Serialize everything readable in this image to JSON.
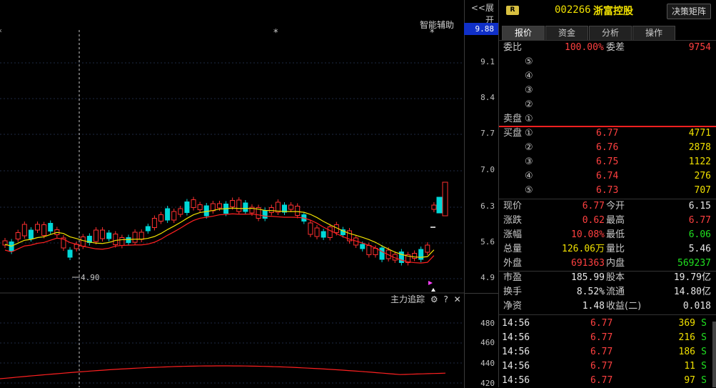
{
  "chart": {
    "expand_label": "<<展开",
    "smart_assist_label": "智能辅助",
    "current_price_tag": "9.88",
    "price_ticks": [
      "9.1",
      "8.4",
      "7.7",
      "7.0",
      "6.3",
      "5.6",
      "4.9"
    ],
    "low_annotation": "4.90",
    "main_track_label": "主力追踪",
    "vol_ticks": [
      "480",
      "460",
      "440",
      "420"
    ],
    "colors": {
      "up": "#ff3030",
      "down": "#00d8d8",
      "ma_yellow": "#f0e000",
      "ma_red": "#ff2020",
      "grid": "#2a2a3a"
    }
  },
  "header": {
    "badge": "R",
    "code": "002266",
    "name": "浙富控股",
    "decision_button": "决策矩阵"
  },
  "tabs": [
    "报价",
    "资金",
    "分析",
    "操作"
  ],
  "commission": {
    "ratio_label": "委比",
    "ratio_value": "100.00%",
    "diff_label": "委差",
    "diff_value": "9754"
  },
  "sell_levels": [
    {
      "label": "⑤"
    },
    {
      "label": "④"
    },
    {
      "label": "③"
    },
    {
      "label": "②"
    },
    {
      "label": "①"
    }
  ],
  "sell_label": "卖盘",
  "buy_label": "买盘",
  "buy_levels": [
    {
      "label": "①",
      "price": "6.77",
      "vol": "4771"
    },
    {
      "label": "②",
      "price": "6.76",
      "vol": "2878"
    },
    {
      "label": "③",
      "price": "6.75",
      "vol": "1122"
    },
    {
      "label": "④",
      "price": "6.74",
      "vol": "276"
    },
    {
      "label": "⑤",
      "price": "6.73",
      "vol": "707"
    }
  ],
  "quote": [
    {
      "l1": "现价",
      "v1": "6.77",
      "l2": "今开",
      "v2": "6.15"
    },
    {
      "l1": "涨跌",
      "v1": "0.62",
      "l2": "最高",
      "v2": "6.77"
    },
    {
      "l1": "涨幅",
      "v1": "10.08%",
      "l2": "最低",
      "v2": "6.06"
    },
    {
      "l1": "总量",
      "v1": "126.06万",
      "l2": "量比",
      "v2": "5.46"
    },
    {
      "l1": "外盘",
      "v1": "691363",
      "l2": "内盘",
      "v2": "569237"
    },
    {
      "l1": "市盈",
      "v1": "185.99",
      "l2": "股本",
      "v2": "19.79亿"
    },
    {
      "l1": "换手",
      "v1": "8.52%",
      "l2": "流通",
      "v2": "14.80亿"
    },
    {
      "l1": "净资",
      "v1": "1.48",
      "l2": "收益(二)",
      "v2": "0.018"
    }
  ],
  "ticks": [
    {
      "time": "14:56",
      "price": "6.77",
      "vol": "369",
      "side": "S"
    },
    {
      "time": "14:56",
      "price": "6.77",
      "vol": "216",
      "side": "S"
    },
    {
      "time": "14:56",
      "price": "6.77",
      "vol": "186",
      "side": "S"
    },
    {
      "time": "14:56",
      "price": "6.77",
      "vol": "11",
      "side": "S"
    },
    {
      "time": "14:56",
      "price": "6.77",
      "vol": "97",
      "side": "S"
    }
  ]
}
